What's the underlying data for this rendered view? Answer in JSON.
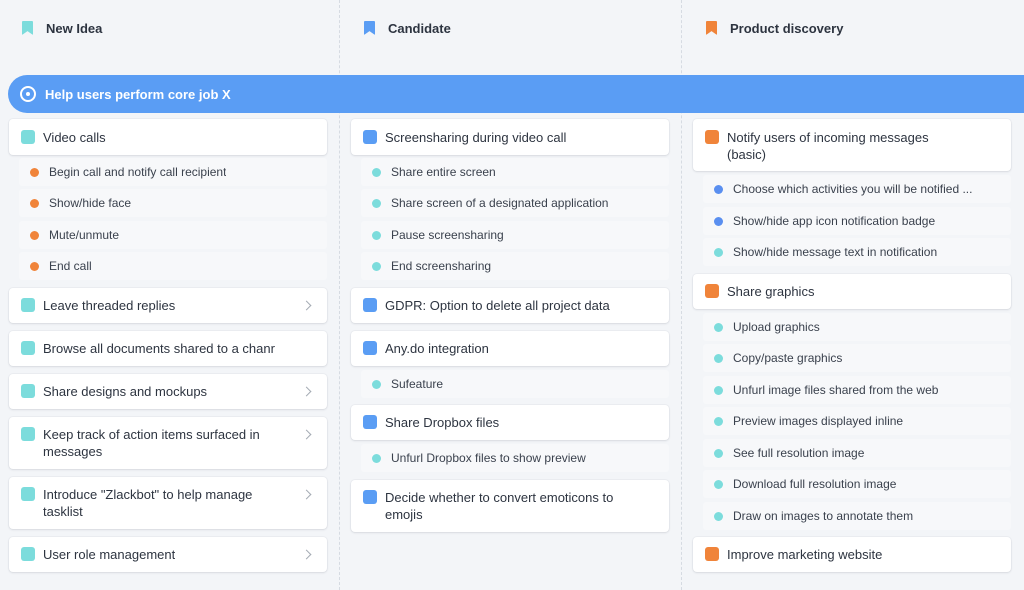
{
  "colors": {
    "teal": "#7cdcdc",
    "blue": "#5a9df4",
    "orange": "#f0843a",
    "goal_bar": "#5a9df4"
  },
  "columns": [
    {
      "title": "New Idea",
      "icon": "bookmark-teal-icon"
    },
    {
      "title": "Candidate",
      "icon": "bookmark-blue-icon"
    },
    {
      "title": "Product discovery",
      "icon": "bookmark-orange-icon"
    }
  ],
  "goal": {
    "label": "Help users perform core job X",
    "icon": "target-icon"
  },
  "new_idea": {
    "video_calls": "Video calls",
    "video_calls_subs": [
      "Begin call and notify call recipient",
      "Show/hide face",
      "Mute/unmute",
      "End call"
    ],
    "leave_threaded": "Leave threaded replies",
    "browse_docs": "Browse all documents shared to a chanr",
    "share_designs": "Share designs and mockups",
    "keep_track": "Keep track of action items surfaced in messages",
    "zlackbot": "Introduce \"Zlackbot\" to help manage tasklist",
    "user_role": "User role management"
  },
  "candidate": {
    "screensharing": "Screensharing during video call",
    "screensharing_subs": [
      "Share entire screen",
      "Share screen of a designated application",
      "Pause screensharing",
      "End screensharing"
    ],
    "gdpr": "GDPR: Option to delete all project data",
    "anydo": "Any.do integration",
    "anydo_subs": [
      "Sufeature"
    ],
    "dropbox": "Share Dropbox files",
    "dropbox_subs": [
      "Unfurl Dropbox files to show preview"
    ],
    "emoticons": "Decide whether to convert emoticons to emojis"
  },
  "discovery": {
    "notify": "Notify users of incoming messages (basic)",
    "notify_subs": [
      "Choose which activities you will be notified ...",
      "Show/hide app icon notification badge",
      "Show/hide message text in notification"
    ],
    "share_graphics": "Share graphics",
    "share_graphics_subs": [
      "Upload graphics",
      "Copy/paste graphics",
      "Unfurl image files shared from the web",
      "Preview images displayed inline",
      "See full resolution image",
      "Download full resolution image",
      "Draw on images to annotate them"
    ],
    "marketing": "Improve marketing website"
  }
}
